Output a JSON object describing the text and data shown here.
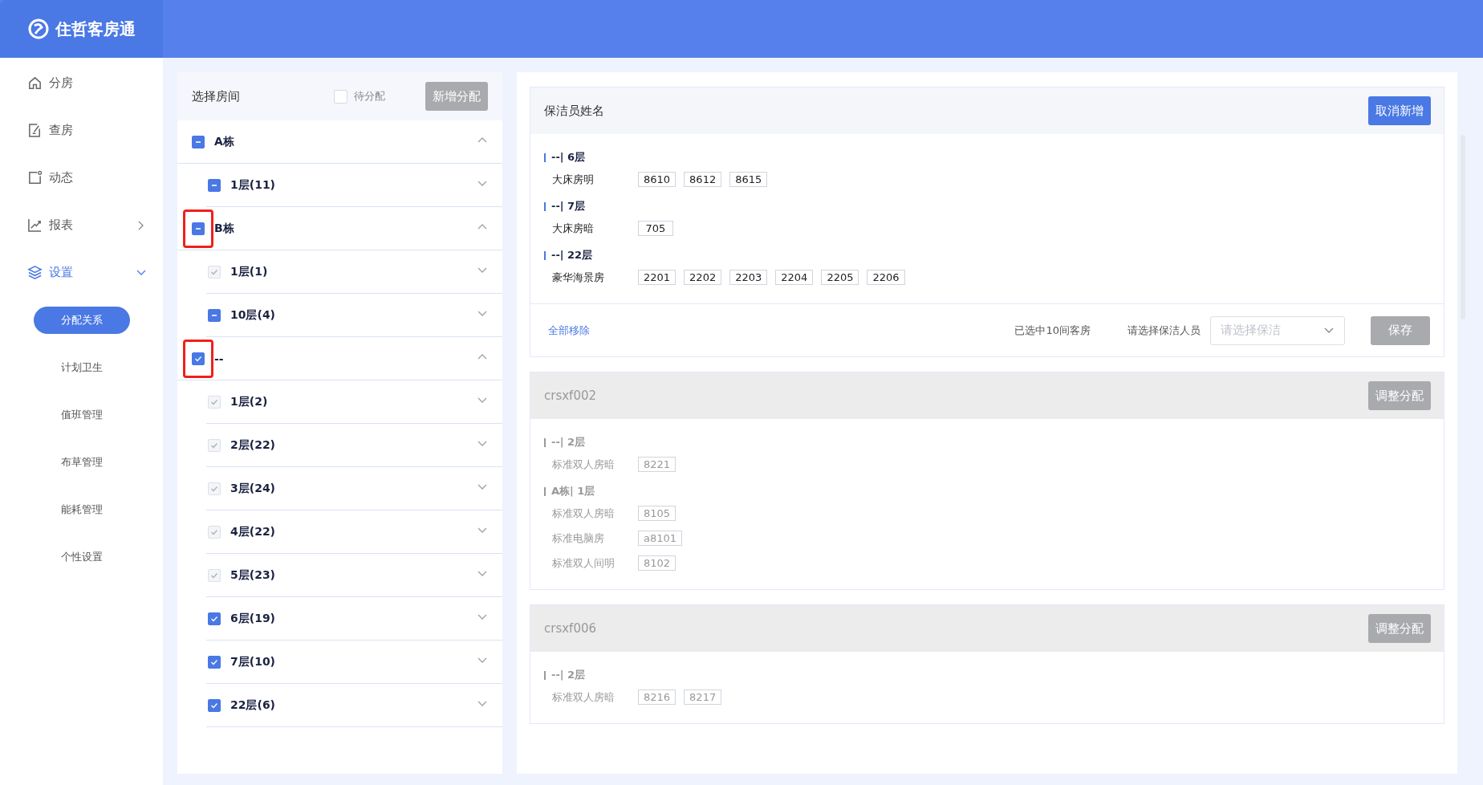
{
  "app": {
    "title": "住哲客房通"
  },
  "menu": [
    {
      "label": "分房",
      "active": false
    },
    {
      "label": "查房",
      "active": false
    },
    {
      "label": "动态",
      "active": false
    },
    {
      "label": "报表",
      "active": false,
      "expanded": false
    },
    {
      "label": "设置",
      "active": true,
      "expanded": true,
      "children": [
        {
          "label": "分配关系",
          "selected": true
        },
        {
          "label": "计划卫生",
          "selected": false
        },
        {
          "label": "值班管理",
          "selected": false
        },
        {
          "label": "布草管理",
          "selected": false
        },
        {
          "label": "能耗管理",
          "selected": false
        },
        {
          "label": "个性设置",
          "selected": false
        }
      ]
    }
  ],
  "room_panel": {
    "title": "选择房间",
    "filter": {
      "label": "待分配",
      "checked": false
    },
    "add_button": {
      "label": "新增分配",
      "disabled": true
    },
    "tree": [
      {
        "label": "A栋",
        "checked": false,
        "indeterminate": true,
        "disabled": false,
        "expanded": true,
        "highlighted": false,
        "children": [
          {
            "label": "1层(11)",
            "checked": false,
            "indeterminate": true,
            "disabled": false,
            "expanded": false
          }
        ]
      },
      {
        "label": "B栋",
        "checked": false,
        "indeterminate": true,
        "disabled": false,
        "expanded": true,
        "highlighted": true,
        "children": [
          {
            "label": "1层(1)",
            "checked": true,
            "disabled": true,
            "expanded": false
          },
          {
            "label": "10层(4)",
            "checked": false,
            "indeterminate": true,
            "disabled": false,
            "expanded": false
          }
        ]
      },
      {
        "label": "--",
        "checked": true,
        "disabled": false,
        "expanded": true,
        "highlighted": true,
        "children": [
          {
            "label": "1层(2)",
            "checked": true,
            "disabled": true,
            "expanded": false
          },
          {
            "label": "2层(22)",
            "checked": true,
            "disabled": true,
            "expanded": false
          },
          {
            "label": "3层(24)",
            "checked": true,
            "disabled": true,
            "expanded": false
          },
          {
            "label": "4层(22)",
            "checked": true,
            "disabled": true,
            "expanded": false
          },
          {
            "label": "5层(23)",
            "checked": true,
            "disabled": true,
            "expanded": false
          },
          {
            "label": "6层(19)",
            "checked": true,
            "disabled": false,
            "expanded": false
          },
          {
            "label": "7层(10)",
            "checked": true,
            "disabled": false,
            "expanded": false
          },
          {
            "label": "22层(6)",
            "checked": true,
            "disabled": false,
            "expanded": false
          }
        ]
      }
    ]
  },
  "cards": [
    {
      "kind": "editing",
      "name": "保洁员姓名",
      "button": "取消新增",
      "groups": [
        {
          "title": "--| 6层",
          "rows": [
            {
              "type": "大床房明",
              "rooms": [
                "8610",
                "8612",
                "8615"
              ]
            }
          ]
        },
        {
          "title": "--| 7层",
          "rows": [
            {
              "type": "大床房暗",
              "rooms": [
                "705"
              ]
            }
          ]
        },
        {
          "title": "--| 22层",
          "rows": [
            {
              "type": "豪华海景房",
              "rooms": [
                "2201",
                "2202",
                "2203",
                "2204",
                "2205",
                "2206"
              ]
            }
          ]
        }
      ],
      "footer": {
        "remove_link": "全部移除",
        "summary": "已选中10间客房",
        "cleaner_label": "请选择保洁人员",
        "cleaner_placeholder": "请选择保洁",
        "save_button": "保存"
      }
    },
    {
      "kind": "assigned",
      "name": "crsxf002",
      "button": "调整分配",
      "groups": [
        {
          "title": "--| 2层",
          "rows": [
            {
              "type": "标准双人房暗",
              "rooms": [
                "8221"
              ]
            }
          ]
        },
        {
          "title": "A栋| 1层",
          "rows": [
            {
              "type": "标准双人房暗",
              "rooms": [
                "8105"
              ]
            },
            {
              "type": "标准电脑房",
              "rooms": [
                "a8101"
              ]
            },
            {
              "type": "标准双人间明",
              "rooms": [
                "8102"
              ]
            }
          ]
        }
      ]
    },
    {
      "kind": "assigned",
      "name": "crsxf006",
      "button": "调整分配",
      "groups": [
        {
          "title": "--| 2层",
          "rows": [
            {
              "type": "标准双人房暗",
              "rooms": [
                "8216",
                "8217"
              ]
            }
          ]
        }
      ]
    }
  ]
}
